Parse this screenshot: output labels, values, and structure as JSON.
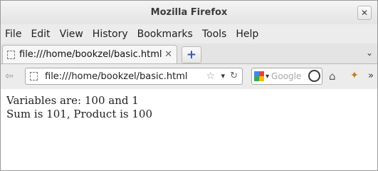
{
  "window": {
    "title": "Mozilla Firefox",
    "close_label": "✕"
  },
  "menubar": {
    "items": [
      "File",
      "Edit",
      "View",
      "History",
      "Bookmarks",
      "Tools",
      "Help"
    ]
  },
  "tabs": {
    "active_label": "file:///home/bookzel/basic.html",
    "close_glyph": "✕",
    "new_tab_glyph": "+",
    "list_glyph": "⌄"
  },
  "navbar": {
    "back_glyph": "⇦",
    "url": "file:///home/bookzel/basic.html",
    "star_glyph": "☆",
    "dropdown_glyph": "▾",
    "reload_glyph": "↻",
    "search_placeholder": "Google",
    "search_dropdown_glyph": "▾",
    "home_glyph": "⌂",
    "addon_glyph": "✦",
    "overflow_glyph": "»"
  },
  "page": {
    "lines": [
      "Variables are: 100 and 1",
      "Sum is 101, Product is 100"
    ]
  },
  "colors": {
    "google_tiles": [
      "#4285f4",
      "#ea4335",
      "#34a853",
      "#fbbc05"
    ]
  }
}
